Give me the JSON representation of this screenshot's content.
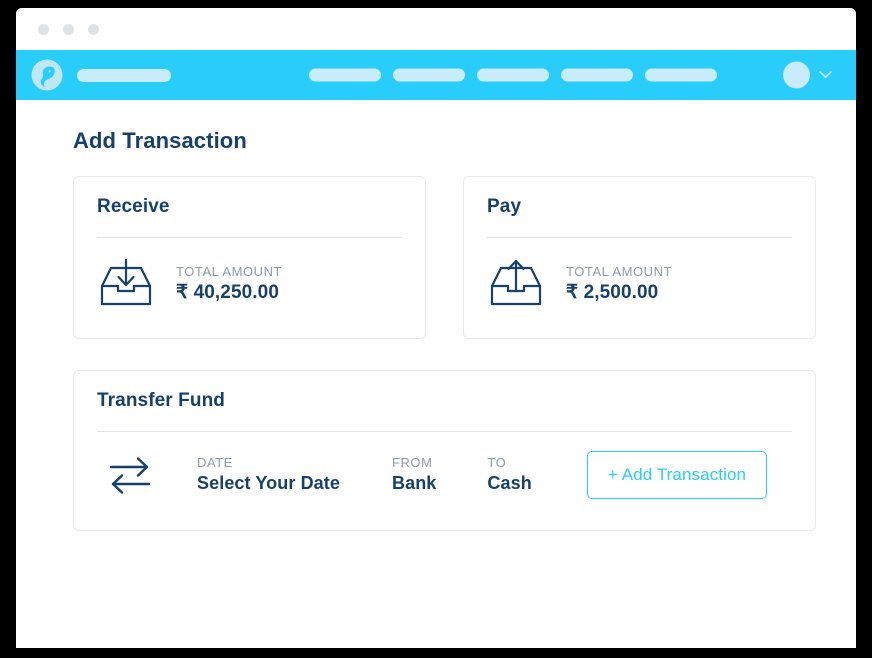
{
  "window": {
    "traffic_lights": [
      "close-dot",
      "minimize-dot",
      "maximize-dot"
    ],
    "accent_color": "#29cdfc",
    "navy_color": "#17416b",
    "muted_color": "#8e9bab"
  },
  "navbar": {
    "logo_icon": "app-logo-icon",
    "brand_placeholder": "",
    "links": [
      {
        "placeholder": ""
      },
      {
        "placeholder": ""
      },
      {
        "placeholder": ""
      },
      {
        "placeholder": ""
      },
      {
        "placeholder": ""
      }
    ],
    "avatar_icon": "avatar",
    "dropdown_icon": "chevron-down-icon"
  },
  "page": {
    "title": "Add Transaction"
  },
  "cards": [
    {
      "title": "Receive",
      "icon": "inbox-download-icon",
      "amount_label": "TOTAL AMOUNT",
      "amount_value": "₹ 40,250.00"
    },
    {
      "title": "Pay",
      "icon": "outbox-upload-icon",
      "amount_label": "TOTAL AMOUNT",
      "amount_value": "₹ 2,500.00"
    }
  ],
  "transfer": {
    "title": "Transfer Fund",
    "icon": "transfer-arrows-icon",
    "fields": [
      {
        "label": "DATE",
        "value": "Select Your Date"
      },
      {
        "label": "FROM",
        "value": "Bank"
      },
      {
        "label": "TO",
        "value": "Cash"
      }
    ],
    "button_label": "+ Add Transaction"
  }
}
